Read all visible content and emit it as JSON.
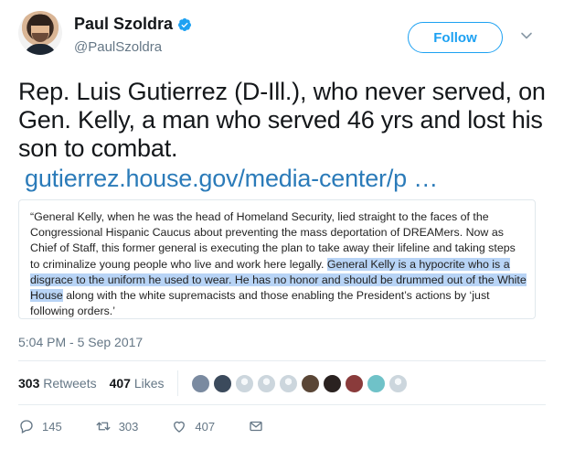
{
  "author": {
    "name": "Paul Szoldra",
    "handle": "@PaulSzoldra",
    "verified": true
  },
  "follow_label": "Follow",
  "tweet": {
    "text": "Rep. Luis Gutierrez (D-Ill.), who never served, on Gen. Kelly, a man who served 46 yrs and lost his son to combat.",
    "link": "gutierrez.house.gov/media-center/p  …"
  },
  "quote": {
    "part1": "“General Kelly, when he was the head of Homeland Security, lied straight to the faces of the Congressional Hispanic Caucus about preventing the mass deportation of DREAMers.  Now as Chief of Staff, this former general is executing the plan to take away their lifeline and taking steps to criminalize young people who live and work here legally.  ",
    "highlighted": "General Kelly is a hypocrite who is a disgrace to the uniform he used to wear.  He has no honor and should be drummed out of the White House",
    "part2": " along with the white supremacists and those enabling the President’s actions by ‘just following orders.’"
  },
  "timestamp": "5:04 PM - 5 Sep 2017",
  "stats": {
    "retweets_count": "303",
    "retweets_label": "Retweets",
    "likes_count": "407",
    "likes_label": "Likes"
  },
  "actions": {
    "replies": "145",
    "retweets": "303",
    "likes": "407"
  },
  "colors": {
    "accent": "#1da1f2",
    "link": "#2b7bb9",
    "muted": "#657786",
    "highlight": "#b8d4f6"
  },
  "likers": [
    {
      "icon": "liker-avatar",
      "color": "#7a8aa0"
    },
    {
      "icon": "liker-avatar",
      "color": "#3b4a5c"
    },
    {
      "icon": "default-avatar",
      "color": "#ccd6dd"
    },
    {
      "icon": "default-avatar",
      "color": "#ccd6dd"
    },
    {
      "icon": "default-avatar",
      "color": "#ccd6dd"
    },
    {
      "icon": "liker-avatar",
      "color": "#5a4636"
    },
    {
      "icon": "liker-avatar",
      "color": "#2a2220"
    },
    {
      "icon": "liker-avatar",
      "color": "#8a3b3b"
    },
    {
      "icon": "liker-avatar",
      "color": "#6fc2c8"
    },
    {
      "icon": "default-avatar",
      "color": "#ccd6dd"
    }
  ]
}
